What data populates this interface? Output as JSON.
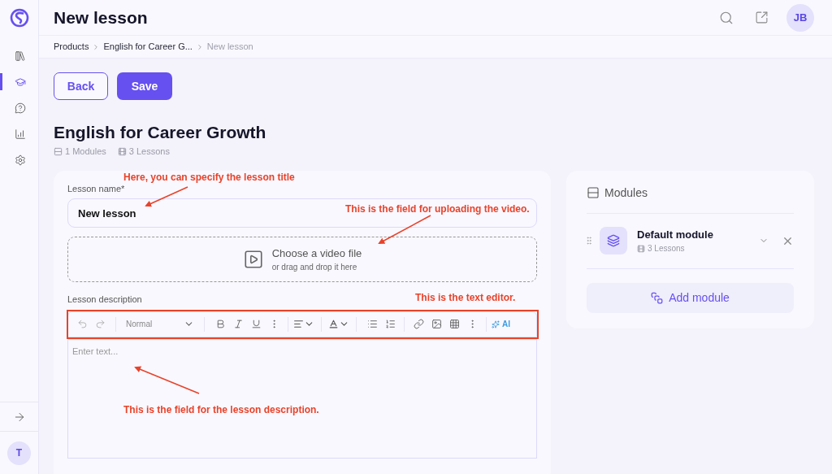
{
  "sidebar": {
    "nav_items": [
      {
        "selected": false
      },
      {
        "selected": true
      },
      {
        "selected": false
      },
      {
        "selected": false
      },
      {
        "selected": false
      }
    ],
    "user_initial": "T"
  },
  "header": {
    "title": "New lesson",
    "avatar": "JB"
  },
  "breadcrumbs": [
    {
      "label": "Products",
      "current": false
    },
    {
      "label": "English for Career G...",
      "current": false
    },
    {
      "label": "New lesson",
      "current": true
    }
  ],
  "actions": {
    "back": "Back",
    "save": "Save"
  },
  "course": {
    "title": "English for Career Growth",
    "modules": "1 Modules",
    "lessons": "3 Lessons"
  },
  "form": {
    "lesson_name": {
      "label": "Lesson name*",
      "value": "New lesson"
    },
    "upload": {
      "title": "Choose a video file",
      "hint": "or drag and drop it here"
    },
    "description": {
      "label": "Lesson description",
      "text_style": "Normal",
      "ai": "AI",
      "placeholder": "Enter text..."
    }
  },
  "modules_panel": {
    "title": "Modules",
    "modules": [
      {
        "name": "Default module",
        "lessons": "3 Lessons"
      }
    ],
    "add": "Add module"
  },
  "annotations": [
    {
      "text": "Here, you can specify the lesson title"
    },
    {
      "text": "This is the field for uploading the video."
    },
    {
      "text": "This is the text editor."
    },
    {
      "text": "This is the field for the lesson description."
    }
  ]
}
